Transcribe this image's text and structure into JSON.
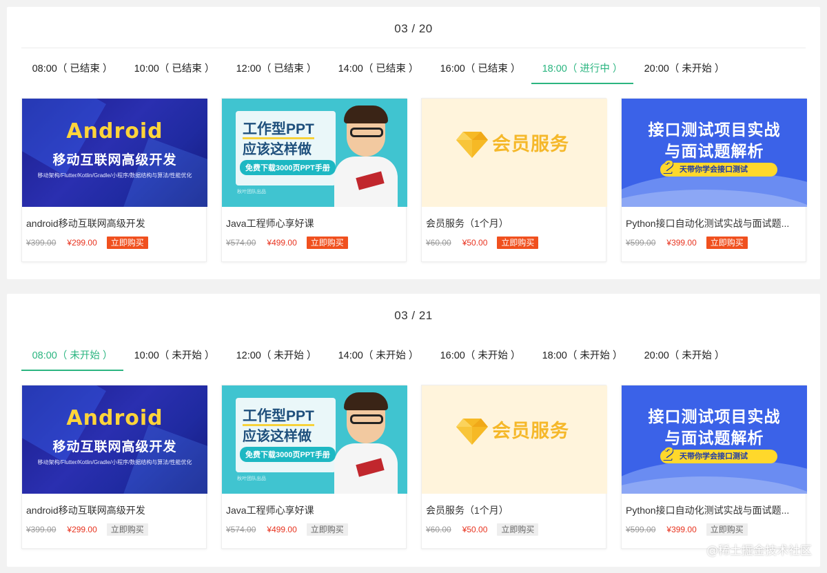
{
  "colors": {
    "accent": "#2bb580",
    "price": "#e8331f",
    "buy_active": "#f0501e",
    "buy_inactive": "#eeeeee"
  },
  "sessions": [
    {
      "date": "03 / 20",
      "tabs": [
        {
          "label": "08:00（ 已结束 ）"
        },
        {
          "label": "10:00（ 已结束 ）"
        },
        {
          "label": "12:00（ 已结束 ）"
        },
        {
          "label": "14:00（ 已结束 ）"
        },
        {
          "label": "16:00（ 已结束 ）"
        },
        {
          "label": "18:00（ 进行中 ）"
        },
        {
          "label": "20:00（ 未开始 ）"
        }
      ],
      "products": [
        {
          "title": "android移动互联网高级开发",
          "old_price": "¥399.00",
          "new_price": "¥299.00",
          "buy": "立即购买"
        },
        {
          "title": "Java工程师心享好课",
          "old_price": "¥574.00",
          "new_price": "¥499.00",
          "buy": "立即购买"
        },
        {
          "title": "会员服务（1个月）",
          "old_price": "¥60.00",
          "new_price": "¥50.00",
          "buy": "立即购买"
        },
        {
          "title": "Python接口自动化测试实战与面试题...",
          "old_price": "¥599.00",
          "new_price": "¥399.00",
          "buy": "立即购买"
        }
      ]
    },
    {
      "date": "03 / 21",
      "tabs": [
        {
          "label": "08:00（ 未开始 ）"
        },
        {
          "label": "10:00（ 未开始 ）"
        },
        {
          "label": "12:00（ 未开始 ）"
        },
        {
          "label": "14:00（ 未开始 ）"
        },
        {
          "label": "16:00（ 未开始 ）"
        },
        {
          "label": "18:00（ 未开始 ）"
        },
        {
          "label": "20:00（ 未开始 ）"
        }
      ],
      "products": [
        {
          "title": "android移动互联网高级开发",
          "old_price": "¥399.00",
          "new_price": "¥299.00",
          "buy": "立即购买"
        },
        {
          "title": "Java工程师心享好课",
          "old_price": "¥574.00",
          "new_price": "¥499.00",
          "buy": "立即购买"
        },
        {
          "title": "会员服务（1个月）",
          "old_price": "¥60.00",
          "new_price": "¥50.00",
          "buy": "立即购买"
        },
        {
          "title": "Python接口自动化测试实战与面试题...",
          "old_price": "¥599.00",
          "new_price": "¥399.00",
          "buy": "立即购买"
        }
      ]
    }
  ],
  "images": {
    "android": {
      "title": "Android",
      "subtitle": "移动互联网高级开发",
      "tags": "移动架构/Flutter/Kotlin/Gradle/小程序/数据结构与算法/性能优化"
    },
    "ppt": {
      "line1": "工作型PPT",
      "line2": "应该这样做",
      "pill": "免费下载3000页PPT手册",
      "footer": "秋叶团队出品"
    },
    "member": {
      "text": "会员服务"
    },
    "api": {
      "line1": "接口测试项目实战",
      "line2": "与面试题解析",
      "num": "2",
      "pill": "天带你学会接口测试"
    }
  },
  "watermark": "@稀土掘金技术社区"
}
